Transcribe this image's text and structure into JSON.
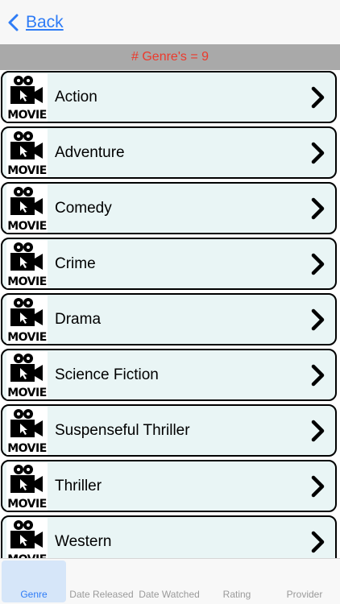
{
  "nav": {
    "back_label": "Back"
  },
  "count_label": "# Genre's = 9",
  "thumb_text": "MOVIE",
  "genres": [
    {
      "label": "Action"
    },
    {
      "label": "Adventure"
    },
    {
      "label": "Comedy"
    },
    {
      "label": "Crime"
    },
    {
      "label": "Drama"
    },
    {
      "label": "Science Fiction"
    },
    {
      "label": "Suspenseful Thriller"
    },
    {
      "label": "Thriller"
    },
    {
      "label": "Western"
    }
  ],
  "tabs": [
    {
      "label": "Genre",
      "selected": true
    },
    {
      "label": "Date Released",
      "selected": false
    },
    {
      "label": "Date Watched",
      "selected": false
    },
    {
      "label": "Rating",
      "selected": false
    },
    {
      "label": "Provider",
      "selected": false
    }
  ],
  "colors": {
    "accent": "#2f7cf6",
    "count_text": "#ec3a2c",
    "row_bg": "#e9f5f5",
    "header_bar": "#a9a9a9"
  },
  "icons": {
    "back": "chevron-left-icon",
    "row_disclosure": "chevron-right-icon",
    "thumbnail": "movie-camera-icon"
  }
}
